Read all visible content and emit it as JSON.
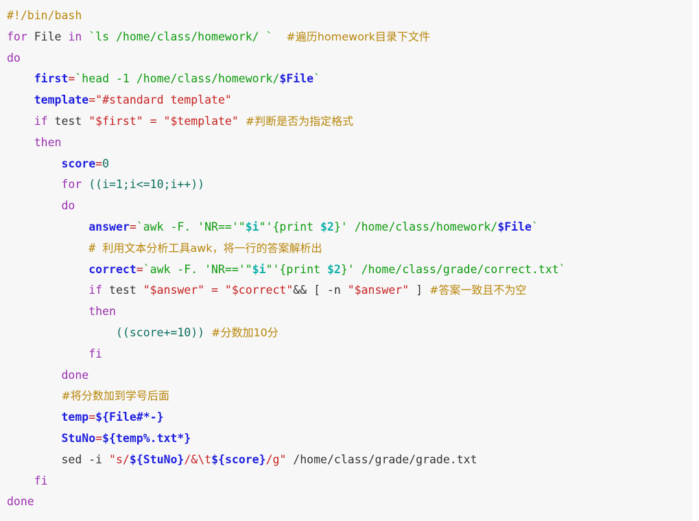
{
  "document": {
    "kind": "bash-script-screenshot",
    "language": "bash",
    "background_color": "#f7f7f7",
    "page_background": "#ffffff",
    "colors": {
      "keyword": "#9B30B0",
      "variable": "#2020E0",
      "operator": "#C02020",
      "string": "#C82020",
      "path": "#0E9B0E",
      "awk_var": "#0EB0A8",
      "arithmetic": "#0B6E5F",
      "comment": "#B8860B",
      "plain": "#333333"
    }
  },
  "lines": [
    {
      "n": 1,
      "text": "#!/bin/bash"
    },
    {
      "n": 2,
      "text": "for File in `ls /home/class/homework/ `  #遍历homework目录下文件"
    },
    {
      "n": 3,
      "text": "do"
    },
    {
      "n": 4,
      "text": "    first=`head -1 /home/class/homework/$File`"
    },
    {
      "n": 5,
      "text": "    template=\"#standard template\""
    },
    {
      "n": 6,
      "text": "    if test \"$first\" = \"$template\" #判断是否为指定格式"
    },
    {
      "n": 7,
      "text": "    then"
    },
    {
      "n": 8,
      "text": "        score=0"
    },
    {
      "n": 9,
      "text": "        for ((i=1;i<=10;i++))"
    },
    {
      "n": 10,
      "text": "        do"
    },
    {
      "n": 11,
      "text": "            answer=`awk -F. 'NR=='\"$i\"'{print $2}' /home/class/homework/$File`"
    },
    {
      "n": 12,
      "text": "            #  利用文本分析工具awk，将一行的答案解析出"
    },
    {
      "n": 13,
      "text": "            correct=`awk -F. 'NR=='\"$i\"'{print $2}' /home/class/grade/correct.txt`"
    },
    {
      "n": 14,
      "text": "            if test \"$answer\" = \"$correct\"&& [ -n \"$answer\" ] #答案一致且不为空"
    },
    {
      "n": 15,
      "text": "            then"
    },
    {
      "n": 16,
      "text": "                ((score+=10)) #分数加10分"
    },
    {
      "n": 17,
      "text": "            fi"
    },
    {
      "n": 18,
      "text": "        done"
    },
    {
      "n": 19,
      "text": "        #将分数加到学号后面"
    },
    {
      "n": 20,
      "text": "        temp=${File#*-}"
    },
    {
      "n": 21,
      "text": "        StuNo=${temp%.txt*}"
    },
    {
      "n": 22,
      "text": "        sed -i \"s/${StuNo}/&\\t${score}/g\" /home/class/grade/grade.txt"
    },
    {
      "n": 23,
      "text": "    fi"
    },
    {
      "n": 24,
      "text": "done"
    }
  ],
  "tokens": {
    "l1": {
      "comment": "#!/bin/bash"
    },
    "l2": {
      "kw_for": "for",
      "var_file": " File ",
      "kw_in": "in ",
      "tick_open": "`",
      "cmd": "ls /home/class/homework/ ",
      "tick_close": "`",
      "gap": "  ",
      "comment": "#遍历homework目录下文件"
    },
    "l3": {
      "kw": "do"
    },
    "l4": {
      "indent": "    ",
      "var": "first",
      "op": "=",
      "tick_open": "`",
      "cmd": "head -1 /home/class/homework/",
      "subvar": "$File",
      "tick_close": "`"
    },
    "l5": {
      "indent": "    ",
      "var": "template",
      "op": "=",
      "str": "\"#standard template\""
    },
    "l6": {
      "indent": "    ",
      "kw_if": "if",
      "cmd": " test ",
      "str1": "\"$first\"",
      "op": " = ",
      "str2": "\"$template\"",
      "gap": " ",
      "comment": "#判断是否为指定格式"
    },
    "l7": {
      "indent": "    ",
      "kw": "then"
    },
    "l8": {
      "indent": "        ",
      "var": "score",
      "op": "=",
      "num": "0"
    },
    "l9": {
      "indent": "        ",
      "kw_for": "for",
      "expr": " ((i=1;i<=10;i++))"
    },
    "l10": {
      "indent": "        ",
      "kw": "do"
    },
    "l11": {
      "indent": "            ",
      "var": "answer",
      "op": "=",
      "tick_open": "`",
      "cmd": "awk -F. 'NR=='\"",
      "awkvar1": "$i",
      "cmd2": "\"'{print ",
      "awkvar2": "$2",
      "cmd3": "}' ",
      "path": "/home/class/homework/",
      "subvar": "$File",
      "tick_close": "`"
    },
    "l12": {
      "indent": "            ",
      "comment_hash": "#",
      "comment": "  利用文本分析工具awk，将一行的答案解析出"
    },
    "l13": {
      "indent": "            ",
      "var": "correct",
      "op": "=",
      "tick_open": "`",
      "cmd": "awk -F. 'NR=='\"",
      "awkvar1": "$i",
      "cmd2": "\"'{print ",
      "awkvar2": "$2",
      "cmd3": "}' ",
      "path": "/home/class/grade/correct.txt",
      "tick_close": "`"
    },
    "l14": {
      "indent": "            ",
      "kw_if": "if",
      "cmd": " test ",
      "str1": "\"$answer\"",
      "op": " = ",
      "str2": "\"$correct\"",
      "amp": "&& [ -n ",
      "str3": "\"$answer\"",
      "bracket": " ] ",
      "comment": "#答案一致且不为空"
    },
    "l15": {
      "indent": "            ",
      "kw": "then"
    },
    "l16": {
      "indent": "                ",
      "expr": "((score+=10))",
      "gap": " ",
      "comment": "#分数加10分"
    },
    "l17": {
      "indent": "            ",
      "kw": "fi"
    },
    "l18": {
      "indent": "        ",
      "kw": "done"
    },
    "l19": {
      "indent": "        ",
      "comment": "#将分数加到学号后面"
    },
    "l20": {
      "indent": "        ",
      "var": "temp",
      "op": "=",
      "expansion": "${File#*-}"
    },
    "l21": {
      "indent": "        ",
      "var": "StuNo",
      "op": "=",
      "expansion": "${temp%.txt*}"
    },
    "l22": {
      "indent": "        ",
      "cmd": "sed -i ",
      "q1": "\"",
      "s1": "s/",
      "v1": "${StuNo}",
      "s2": "/&\\t",
      "v2": "${score}",
      "s3": "/g",
      "q2": "\"",
      "path": " /home/class/grade/grade.txt"
    },
    "l23": {
      "indent": "    ",
      "kw": "fi"
    },
    "l24": {
      "kw": "done"
    }
  }
}
